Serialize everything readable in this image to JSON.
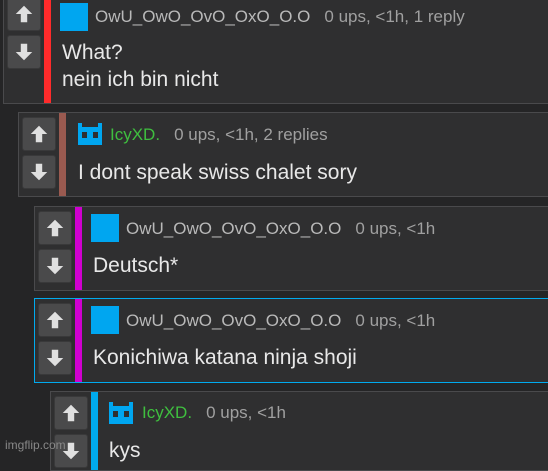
{
  "colors": {
    "background": "#252526",
    "card": "#2f2f30",
    "vote_button": "#4a4a4b",
    "accent_red": "#ff2b2b",
    "accent_brown": "#9a5a50",
    "accent_magenta": "#d000d0",
    "accent_cyan": "#00aaee",
    "avatar_blue": "#00a6f0",
    "username_green": "#3fbf3f"
  },
  "icons": {
    "upvote": "arrow-up-icon",
    "downvote": "arrow-down-icon",
    "avatar_square": "blue-square-avatar",
    "avatar_cat": "blue-cat-avatar"
  },
  "comments": [
    {
      "username": "OwU_OwO_OvO_OxO_O.O",
      "stats": "0 ups, <1h, 1 reply",
      "lines": [
        "What?",
        "nein ich bin nicht"
      ],
      "accent": "red"
    },
    {
      "username": "IcyXD.",
      "stats": "0 ups, <1h, 2 replies",
      "lines": [
        "I dont speak swiss chalet sory"
      ],
      "accent": "brown"
    },
    {
      "username": "OwU_OwO_OvO_OxO_O.O",
      "stats": "0 ups, <1h",
      "lines": [
        "Deutsch*"
      ],
      "accent": "magenta"
    },
    {
      "username": "OwU_OwO_OvO_OxO_O.O",
      "stats": "0 ups, <1h",
      "lines": [
        "Konichiwa katana ninja shoji"
      ],
      "accent": "magenta"
    },
    {
      "username": "IcyXD.",
      "stats": "0 ups, <1h",
      "lines": [
        "kys"
      ],
      "accent": "cyan"
    }
  ],
  "footer": {
    "brand": "imgflip.com"
  }
}
